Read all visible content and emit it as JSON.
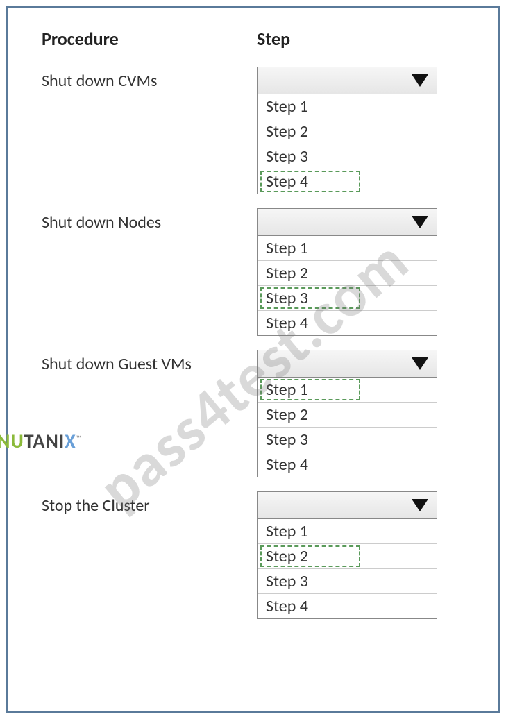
{
  "headers": {
    "procedure": "Procedure",
    "step": "Step"
  },
  "procedures": [
    {
      "label": "Shut  down CVMs",
      "highlight": 3
    },
    {
      "label": "Shut down Nodes",
      "highlight": 2
    },
    {
      "label": "Shut down Guest VMs",
      "highlight": 0
    },
    {
      "label": "Stop the Cluster",
      "highlight": 1
    }
  ],
  "steps": [
    "Step 1",
    "Step 2",
    "Step 3",
    "Step 4"
  ],
  "watermark": "pass4test.com",
  "logo_parts": {
    "nu": "NU",
    "tan": "TANI",
    "x": "X",
    "tm": "™"
  }
}
